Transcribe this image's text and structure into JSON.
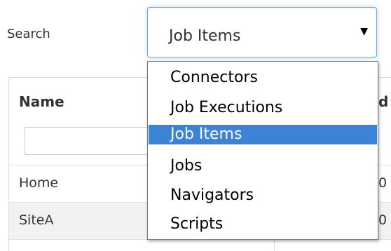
{
  "search": {
    "label": "Search",
    "selected_value": "Job Items",
    "caret": "▼"
  },
  "dropdown": {
    "options": [
      "Connectors",
      "Job Executions",
      "Job Items",
      "Jobs",
      "Navigators",
      "Scripts"
    ],
    "selected_index": 2
  },
  "grid": {
    "columns": [
      "Name",
      "d"
    ],
    "rows": [
      {
        "name": "Home",
        "col2": "0"
      },
      {
        "name": "SiteA",
        "col2": "0"
      }
    ]
  },
  "colors": {
    "selected_option_bg": "#3b83d6",
    "focus_border": "#66afe9",
    "row_alt_bg": "#f2f2f2"
  }
}
